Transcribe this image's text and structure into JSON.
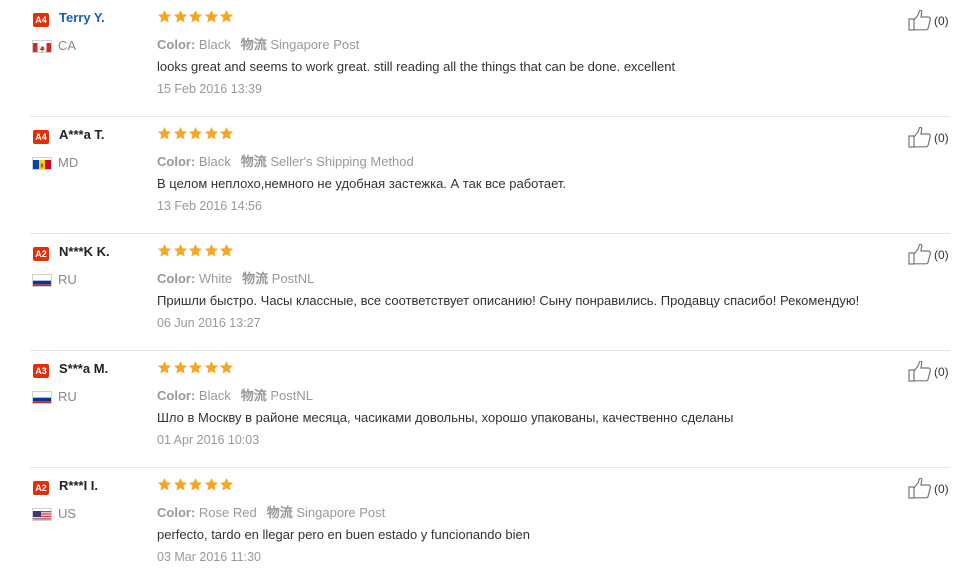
{
  "labels": {
    "color_label": "Color:",
    "shipping_label": "物流"
  },
  "reviews": [
    {
      "level": "A4",
      "name": "Terry Y.",
      "name_is_link": true,
      "country": "CA",
      "rating": 5,
      "color": "Black",
      "shipping": "Singapore Post",
      "text": "looks great and seems to work great. still reading all the things that can be done. excellent",
      "date": "15 Feb 2016 13:39",
      "helpful": "(0)"
    },
    {
      "level": "A4",
      "name": "A***a T.",
      "name_is_link": false,
      "country": "MD",
      "rating": 5,
      "color": "Black",
      "shipping": "Seller's Shipping Method",
      "text": "В целом неплохо,немного не удобная застежка. А так все работает.",
      "date": "13 Feb 2016 14:56",
      "helpful": "(0)"
    },
    {
      "level": "A2",
      "name": "N***K K.",
      "name_is_link": false,
      "country": "RU",
      "rating": 5,
      "color": "White",
      "shipping": "PostNL",
      "text": "Пришли быстро. Часы классные, все соответствует описанию! Сыну понравились. Продавцу спасибо! Рекомендую!",
      "date": "06 Jun 2016 13:27",
      "helpful": "(0)"
    },
    {
      "level": "A3",
      "name": "S***a M.",
      "name_is_link": false,
      "country": "RU",
      "rating": 5,
      "color": "Black",
      "shipping": "PostNL",
      "text": "Шло в Москву в районе месяца, часиками довольны, хорошо упакованы, качественно сделаны",
      "date": "01 Apr 2016 10:03",
      "helpful": "(0)"
    },
    {
      "level": "A2",
      "name": "R***I I.",
      "name_is_link": false,
      "country": "US",
      "rating": 5,
      "color": "Rose Red",
      "shipping": "Singapore Post",
      "text": "perfecto, tardo en llegar pero en buen estado y funcionando bien",
      "date": "03 Mar 2016 11:30",
      "helpful": "(0)"
    }
  ],
  "colors": {
    "star": "#f5a623",
    "badge": "#e62e04",
    "link": "#1a5fb4",
    "muted": "#999999",
    "text": "#333333"
  }
}
